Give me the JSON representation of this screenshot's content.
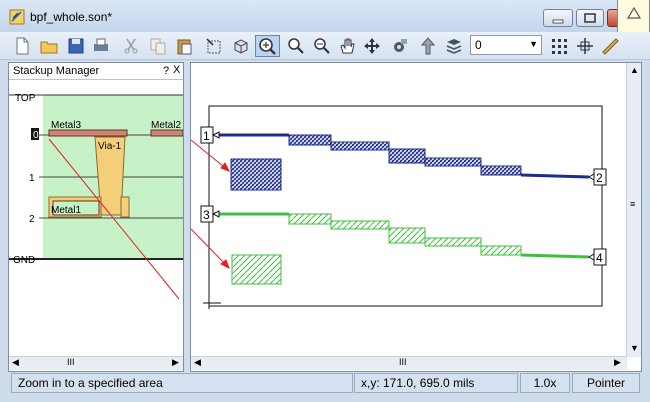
{
  "window": {
    "title": "bpf_whole.son*"
  },
  "toolbar": {
    "icons": [
      "new-icon",
      "open-icon",
      "save-icon",
      "print-icon",
      "cut-icon",
      "copy-icon",
      "paste-icon",
      "select-icon",
      "3d-view-icon",
      "zoom-area-icon",
      "zoom-in-icon",
      "zoom-out-icon",
      "pan-hand-icon",
      "move-icon",
      "settings-icon",
      "up-level-icon",
      "layers-icon",
      "grid-icon",
      "align-icon",
      "measure-icon"
    ],
    "level_value": "0"
  },
  "stackup": {
    "title": "Stackup Manager",
    "help": "?",
    "close": "X",
    "labels": {
      "top": "TOP",
      "l0": "0",
      "l1": "1",
      "l2": "2",
      "gnd": "GND"
    },
    "metals": {
      "metal3": "Metal3",
      "metal2": "Metal2",
      "metal1": "Metal1",
      "via": "Via-1"
    },
    "scroll_thumb": "III"
  },
  "layout": {
    "ports": [
      "1",
      "2",
      "3",
      "4"
    ],
    "scroll_thumb": "III",
    "colors": {
      "blue_trace": "#1f2d8a",
      "green_trace": "#3fbf3f",
      "arrow": "#e02020"
    }
  },
  "statusbar": {
    "message": "Zoom in to a specified area",
    "coords": "x,y: 171.0, 695.0 mils",
    "zoom": "1.0x",
    "mode": "Pointer"
  }
}
